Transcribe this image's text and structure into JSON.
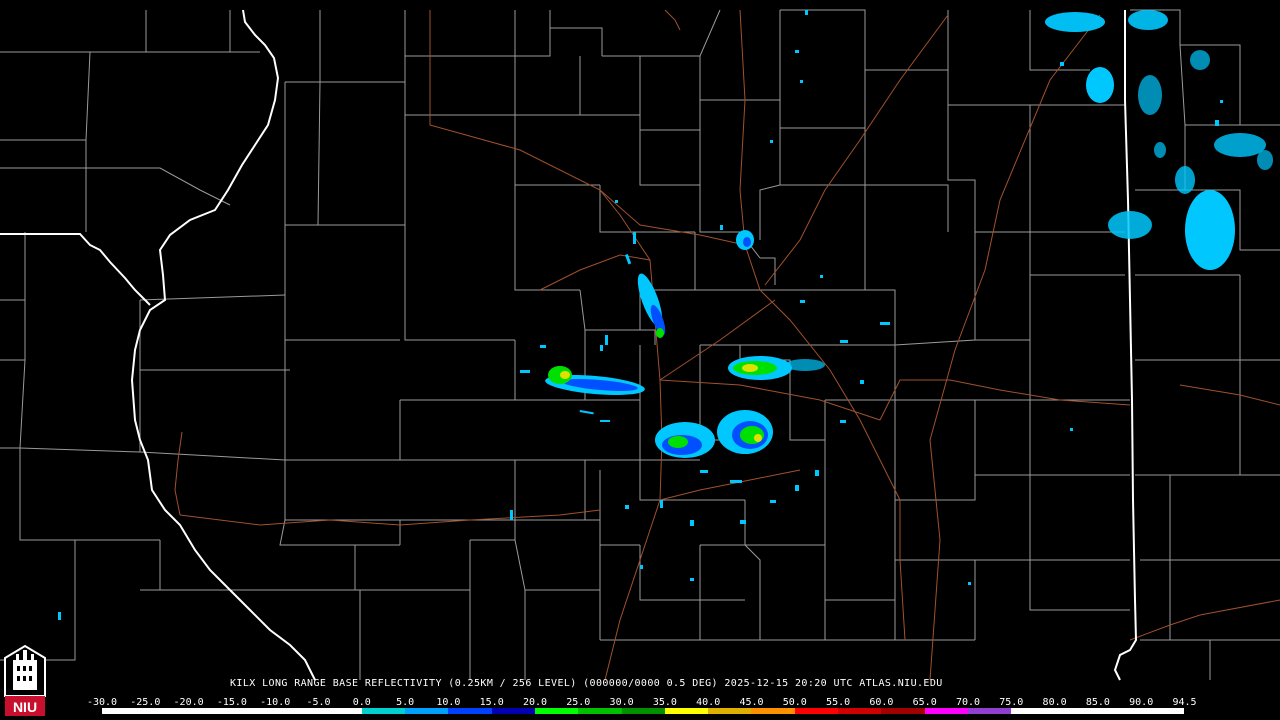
{
  "product_title": "KILX LONG RANGE BASE REFLECTIVITY (0.25KM / 256 LEVEL) (000000/0000 0.5 DEG) 2025-12-15 20:20 UTC  ATLAS.NIU.EDU",
  "logo": {
    "text": "NIU",
    "icon": "niu-tower-shield-icon",
    "color": "#c8102e"
  },
  "legend": {
    "labels": [
      "-30.0",
      "-25.0",
      "-20.0",
      "-15.0",
      "-10.0",
      "-5.0",
      "0.0",
      "5.0",
      "10.0",
      "15.0",
      "20.0",
      "25.0",
      "30.0",
      "35.0",
      "40.0",
      "45.0",
      "50.0",
      "55.0",
      "60.0",
      "65.0",
      "70.0",
      "75.0",
      "80.0",
      "85.0",
      "90.0",
      "94.5"
    ],
    "colors": [
      "#ffffff",
      "#ffffff",
      "#ffffff",
      "#ffffff",
      "#ffffff",
      "#ffffff",
      "#00d0d0",
      "#00a0ff",
      "#0040ff",
      "#0000b0",
      "#00ff00",
      "#00c000",
      "#009000",
      "#ffff00",
      "#e0b000",
      "#ff9000",
      "#ff0000",
      "#d00000",
      "#a00000",
      "#ff00ff",
      "#9040d0",
      "#ffffff",
      "#ffffff",
      "#ffffff",
      "#ffffff"
    ]
  },
  "map_colors": {
    "county_lines": "#9a9a9a",
    "state_lines": "#ffffff",
    "highways": "#a0522d",
    "echo_light": "#00c8ff",
    "echo_mid": "#0050ff",
    "echo_strong": "#00e000",
    "echo_peak": "#e0e000"
  }
}
